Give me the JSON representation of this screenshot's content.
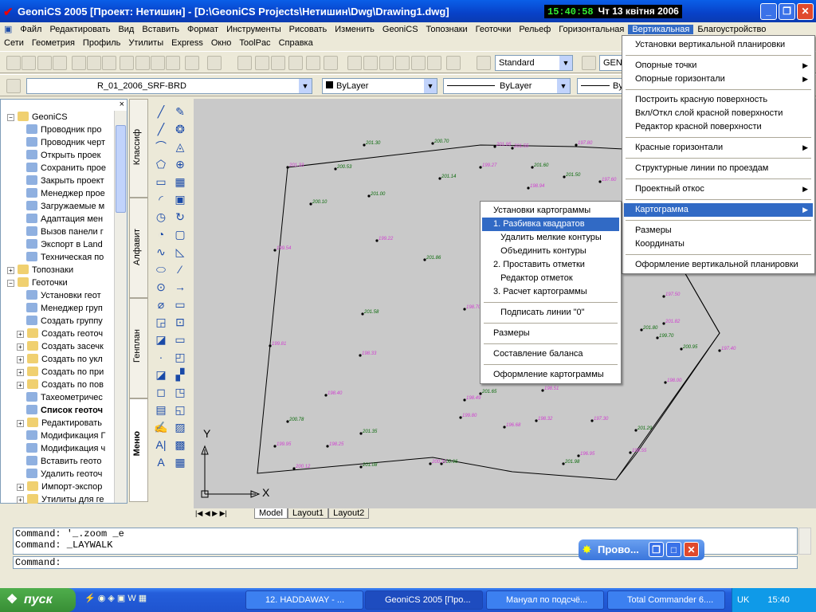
{
  "window": {
    "title": "GeoniCS 2005 [Проект: Нетишин] - [D:\\GeoniCS Projects\\Нетишин\\Dwg\\Drawing1.dwg]",
    "clock_time": "15:40:58",
    "clock_date": "Чт 13 квітня 2006"
  },
  "menubar_row1": [
    "Файл",
    "Редактировать",
    "Вид",
    "Вставить",
    "Формат",
    "Инструменты",
    "Рисовать",
    "Изменить",
    "GeoniCS",
    "Топознаки",
    "Геоточки",
    "Рельеф",
    "Горизонтальная",
    "Вертикальная",
    "Благоустройство"
  ],
  "menubar_row2": [
    "Сети",
    "Геометрия",
    "Профиль",
    "Утилиты",
    "Express",
    "Окно",
    "ToolPac",
    "Справка"
  ],
  "toolbar": {
    "text_style": "Standard",
    "dim_style_partial": "GEN",
    "layer": "R_01_2006_SRF-BRD",
    "color": "ByLayer",
    "linetype": "ByLayer",
    "lineweight_partial": "By"
  },
  "tree": [
    {
      "label": "GeoniCS",
      "indent": 0,
      "pm": "−"
    },
    {
      "label": "Проводник про",
      "indent": 2
    },
    {
      "label": "Проводник черт",
      "indent": 2
    },
    {
      "label": "Открыть проек",
      "indent": 2
    },
    {
      "label": "Сохранить прое",
      "indent": 2
    },
    {
      "label": "Закрыть проект",
      "indent": 2
    },
    {
      "label": "Менеджер прое",
      "indent": 2
    },
    {
      "label": "Загружаемые м",
      "indent": 2
    },
    {
      "label": "Адаптация мен",
      "indent": 2
    },
    {
      "label": "Вызов панели г",
      "indent": 2
    },
    {
      "label": "Экспорт в Land",
      "indent": 2
    },
    {
      "label": "Техническая по",
      "indent": 2
    },
    {
      "label": "Топознаки",
      "indent": 0,
      "pm": "+"
    },
    {
      "label": "Геоточки",
      "indent": 0,
      "pm": "−"
    },
    {
      "label": "Установки геот",
      "indent": 2
    },
    {
      "label": "Менеджер груп",
      "indent": 2
    },
    {
      "label": "Создать группу",
      "indent": 2
    },
    {
      "label": "Создать геоточ",
      "indent": 1,
      "pm": "+"
    },
    {
      "label": "Создать засечк",
      "indent": 1,
      "pm": "+"
    },
    {
      "label": "Создать по укл",
      "indent": 1,
      "pm": "+"
    },
    {
      "label": "Создать по при",
      "indent": 1,
      "pm": "+"
    },
    {
      "label": "Создать по пов",
      "indent": 1,
      "pm": "+"
    },
    {
      "label": "Тахеометричес",
      "indent": 2
    },
    {
      "label": "Список геоточ",
      "indent": 2,
      "bold": true
    },
    {
      "label": "Редактировать",
      "indent": 1,
      "pm": "+"
    },
    {
      "label": "Модификация Г",
      "indent": 2
    },
    {
      "label": "Модификация ч",
      "indent": 2
    },
    {
      "label": "Вставить геото",
      "indent": 2
    },
    {
      "label": "Удалить геоточ",
      "indent": 2
    },
    {
      "label": "Импорт-экспор",
      "indent": 1,
      "pm": "+"
    },
    {
      "label": "Утилиты для ге",
      "indent": 1,
      "pm": "+"
    }
  ],
  "vtabs": [
    "Классиф",
    "Алфавит",
    "Генплан",
    "Меню"
  ],
  "drawing_tabs": [
    "Model",
    "Layout1",
    "Layout2"
  ],
  "axis_labels": {
    "y": "Y",
    "x": "X"
  },
  "command_history": [
    "Command:  '_.zoom _e",
    "Command:  _LAYWALK"
  ],
  "command_prompt": "Command:",
  "vertical_menu": [
    {
      "label": "Установки вертикальной планировки"
    },
    {
      "sep": true
    },
    {
      "label": "Опорные точки",
      "sub": true
    },
    {
      "label": "Опорные горизонтали",
      "sub": true
    },
    {
      "sep": true
    },
    {
      "label": "Построить красную поверхность"
    },
    {
      "label": "Вкл/Откл слой красной поверхности"
    },
    {
      "label": "Редактор красной поверхности"
    },
    {
      "sep": true
    },
    {
      "label": "Красные горизонтали",
      "sub": true
    },
    {
      "sep": true
    },
    {
      "label": "Структурные линии по проездам"
    },
    {
      "sep": true
    },
    {
      "label": "Проектный откос",
      "sub": true
    },
    {
      "sep": true
    },
    {
      "label": "Картограмма",
      "sub": true,
      "hl": true
    },
    {
      "sep": true
    },
    {
      "label": "Размеры"
    },
    {
      "label": "Координаты"
    },
    {
      "sep": true
    },
    {
      "label": "Оформление вертикальной планировки"
    }
  ],
  "kartogramma_menu": [
    {
      "label": "Установки картограммы"
    },
    {
      "label": "1. Разбивка квадратов",
      "hl": true
    },
    {
      "label": "   Удалить мелкие контуры"
    },
    {
      "label": "   Объединить контуры"
    },
    {
      "label": "2. Проставить отметки"
    },
    {
      "label": "   Редактор отметок"
    },
    {
      "label": "3. Расчет картограммы"
    },
    {
      "sep": true
    },
    {
      "label": "   Подписать линии \"0\""
    },
    {
      "sep": true
    },
    {
      "label": "Размеры"
    },
    {
      "sep": true
    },
    {
      "label": "Составление баланса"
    },
    {
      "sep": true
    },
    {
      "label": "Оформление картограммы"
    }
  ],
  "proxy_window_title": "Прово...",
  "taskbar": {
    "start": "пуск",
    "tasks": [
      "12. HADDAWAY - ...",
      "GeoniCS 2005 [Про...",
      "Мануал по подсчё...",
      "Total Commander 6...."
    ],
    "lang": "UK",
    "time": "15:40"
  },
  "survey_points": {
    "green": [
      "201.30",
      "200.70",
      "200.53",
      "201.14",
      "201.00",
      "200.10",
      "201.86",
      "201.65",
      "201.35",
      "200.78",
      "201.58",
      "201.08",
      "200.96",
      "201.80",
      "200.95",
      "201.29",
      "201.98",
      "199.70",
      "201.60",
      "201.50"
    ],
    "magenta": [
      "201.33",
      "201.55",
      "201.95",
      "199.22",
      "199.54",
      "199.81",
      "198.33",
      "199.80",
      "199.95",
      "200.12",
      "197.40",
      "196.68",
      "197.80",
      "197.60",
      "198.20",
      "197.50",
      "198.00",
      "198.51",
      "198.32",
      "199.55",
      "198.40",
      "197.30",
      "196.95",
      "198.25",
      "198.49",
      "199.27",
      "200.33",
      "201.82",
      "198.94",
      "198.70"
    ]
  }
}
